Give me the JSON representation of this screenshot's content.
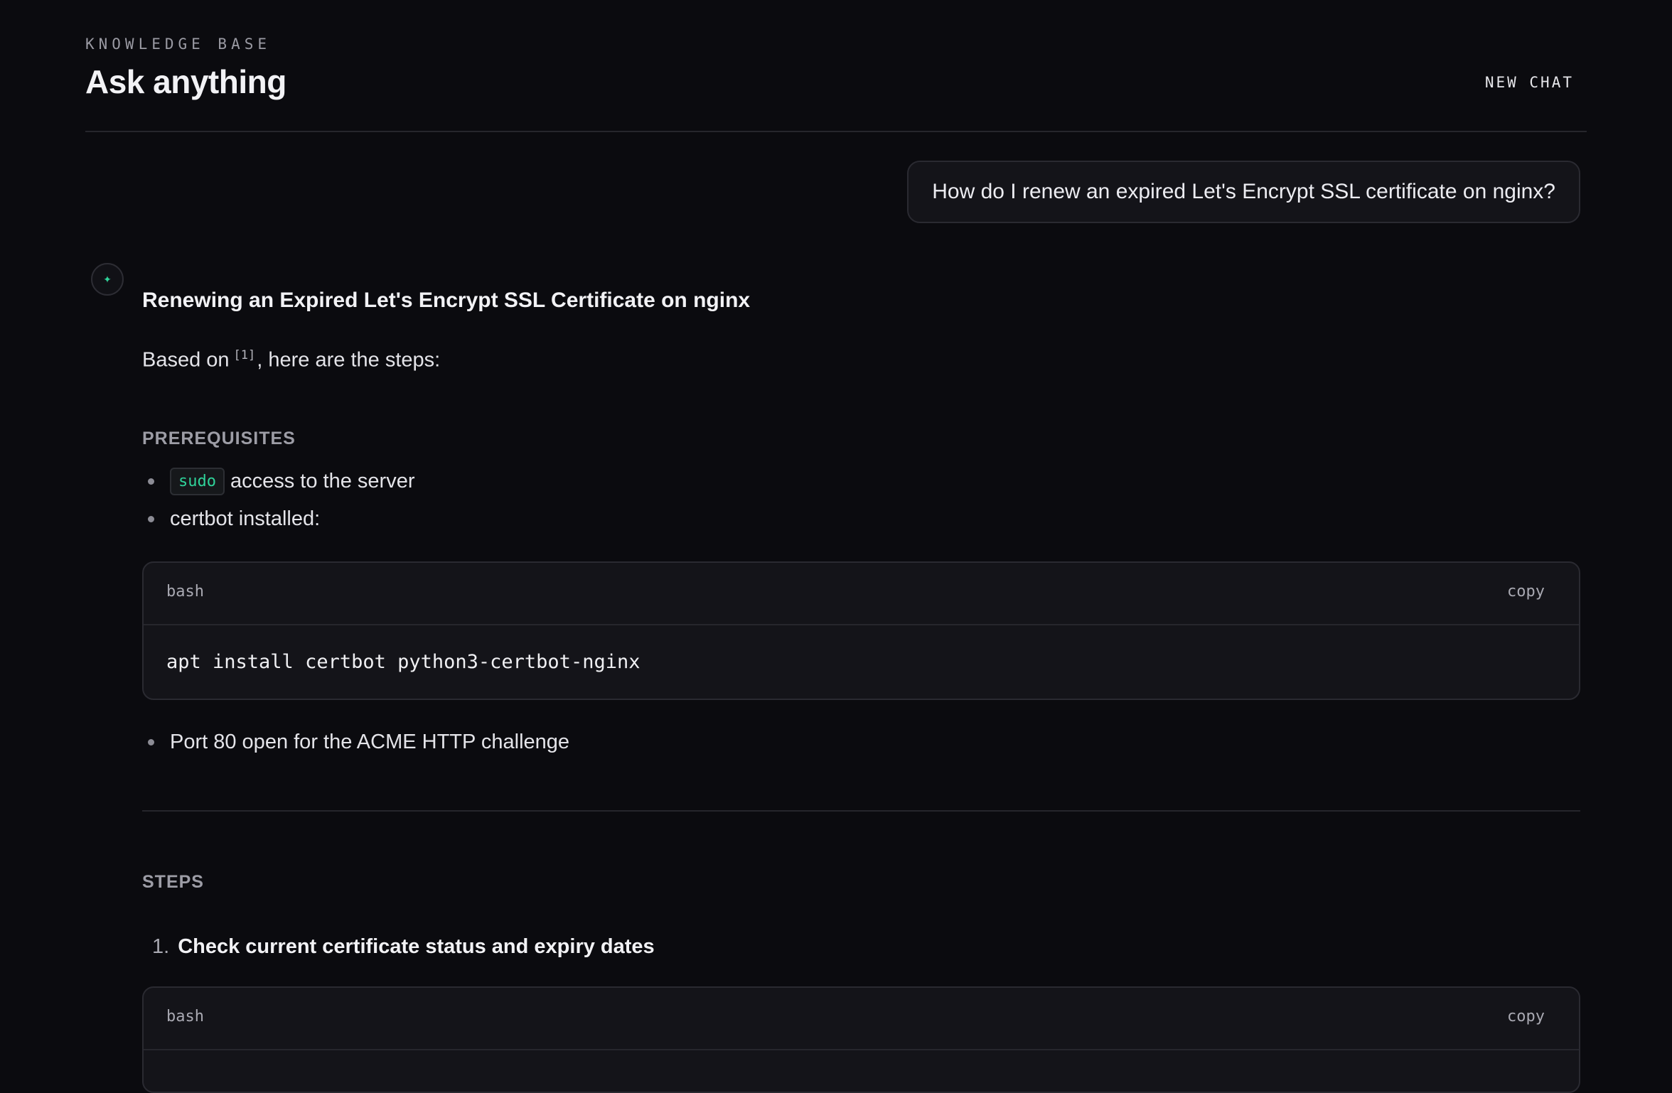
{
  "header": {
    "eyebrow": "KNOWLEDGE BASE",
    "title": "Ask anything",
    "new_chat_label": "NEW CHAT"
  },
  "user_message": {
    "text": "How do I renew an expired Let's Encrypt SSL certificate on nginx?"
  },
  "assistant": {
    "avatar_icon": "sparkle-icon",
    "accent_color": "#2fd39a",
    "title": "Renewing an Expired Let's Encrypt SSL Certificate on nginx",
    "intro_before": "Based on",
    "citation": "[1]",
    "intro_after": ", here are the steps:",
    "prerequisites": {
      "label": "PREREQUISITES",
      "item1_code": "sudo",
      "item1_text": "access to the server",
      "item2_text": "certbot installed:",
      "code": {
        "lang": "bash",
        "copy_label": "copy",
        "command": "apt install certbot python3-certbot-nginx"
      },
      "item3_text": "Port 80 open for the ACME HTTP challenge"
    },
    "steps": {
      "label": "STEPS",
      "step1_num": "1.",
      "step1_text": "Check current certificate status and expiry dates",
      "step1_code": {
        "lang": "bash",
        "copy_label": "copy"
      }
    }
  }
}
